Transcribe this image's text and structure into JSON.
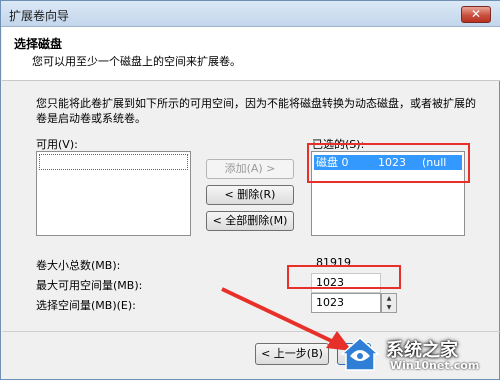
{
  "window": {
    "title": "扩展卷向导"
  },
  "header": {
    "title": "选择磁盘",
    "subtitle": "您可以用至少一个磁盘上的空间来扩展卷。"
  },
  "description": "您只能将此卷扩展到如下所示的可用空间，因为不能将磁盘转换为动态磁盘，或者被扩展的卷是启动卷或系统卷。",
  "available": {
    "label": "可用(V):"
  },
  "selected": {
    "label": "已选的(S):",
    "items": [
      {
        "disk": "磁盘 0",
        "size": "1023",
        "extra": "(null"
      }
    ]
  },
  "buttons": {
    "add": "添加(A) >",
    "remove": "< 删除(R)",
    "remove_all": "< 全部删除(M)",
    "back": "< 上一步(B)",
    "next": ""
  },
  "fields": {
    "total_label": "卷大小总数(MB):",
    "total_value": "81919",
    "max_label": "最大可用空间量(MB):",
    "max_value": "1023",
    "select_label": "选择空间量(MB)(E):",
    "select_value": "1023"
  },
  "watermark": {
    "brand": "系统之家",
    "url": "Win10net.com"
  },
  "colors": {
    "highlight": "#3399ff",
    "annotation": "#e8302a"
  }
}
